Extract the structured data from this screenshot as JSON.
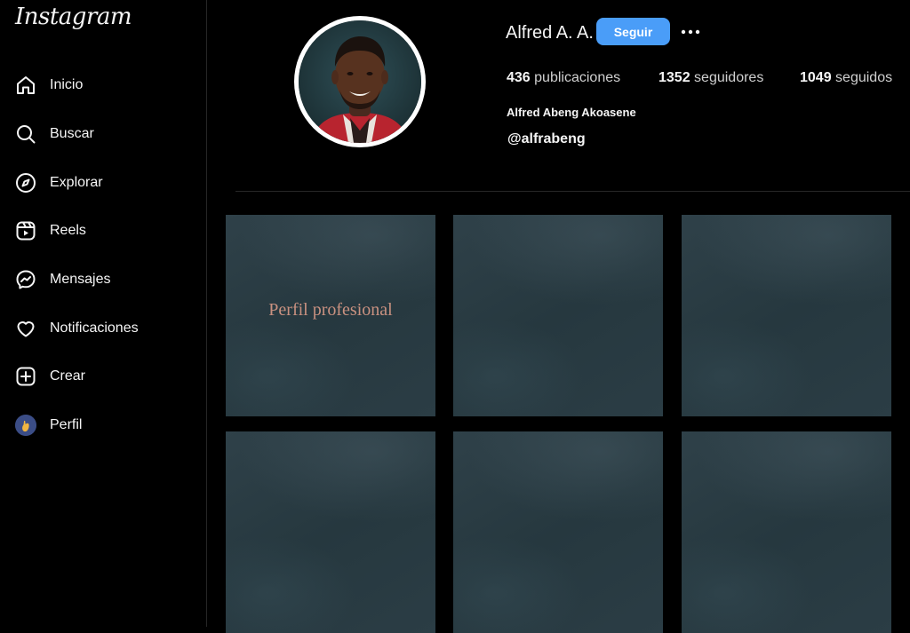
{
  "app": {
    "logo": "Instagram"
  },
  "sidebar": {
    "items": [
      {
        "label": "Inicio",
        "icon": "home-icon"
      },
      {
        "label": "Buscar",
        "icon": "search-icon"
      },
      {
        "label": "Explorar",
        "icon": "compass-icon"
      },
      {
        "label": "Reels",
        "icon": "reels-icon"
      },
      {
        "label": "Mensajes",
        "icon": "messenger-icon"
      },
      {
        "label": "Notificaciones",
        "icon": "heart-icon"
      },
      {
        "label": "Crear",
        "icon": "plus-square-icon"
      },
      {
        "label": "Perfil",
        "icon": "avatar"
      }
    ]
  },
  "profile": {
    "username": "Alfred A. A.",
    "follow_label": "Seguir",
    "stats": {
      "posts_count": "436",
      "posts_label": "publicaciones",
      "followers_count": "1352",
      "followers_label": "seguidores",
      "following_count": "1049",
      "following_label": "seguidos"
    },
    "full_name": "Alfred Abeng Akoasene",
    "handle": "@alfrabeng"
  },
  "posts": [
    {
      "caption": "Perfil profesional"
    },
    {
      "caption": ""
    },
    {
      "caption": ""
    },
    {
      "caption": ""
    },
    {
      "caption": ""
    },
    {
      "caption": ""
    }
  ],
  "colors": {
    "background": "#000000",
    "accent_button": "#4a9df8",
    "post_tile": "#2b3c44",
    "caption_text": "#c99180"
  }
}
